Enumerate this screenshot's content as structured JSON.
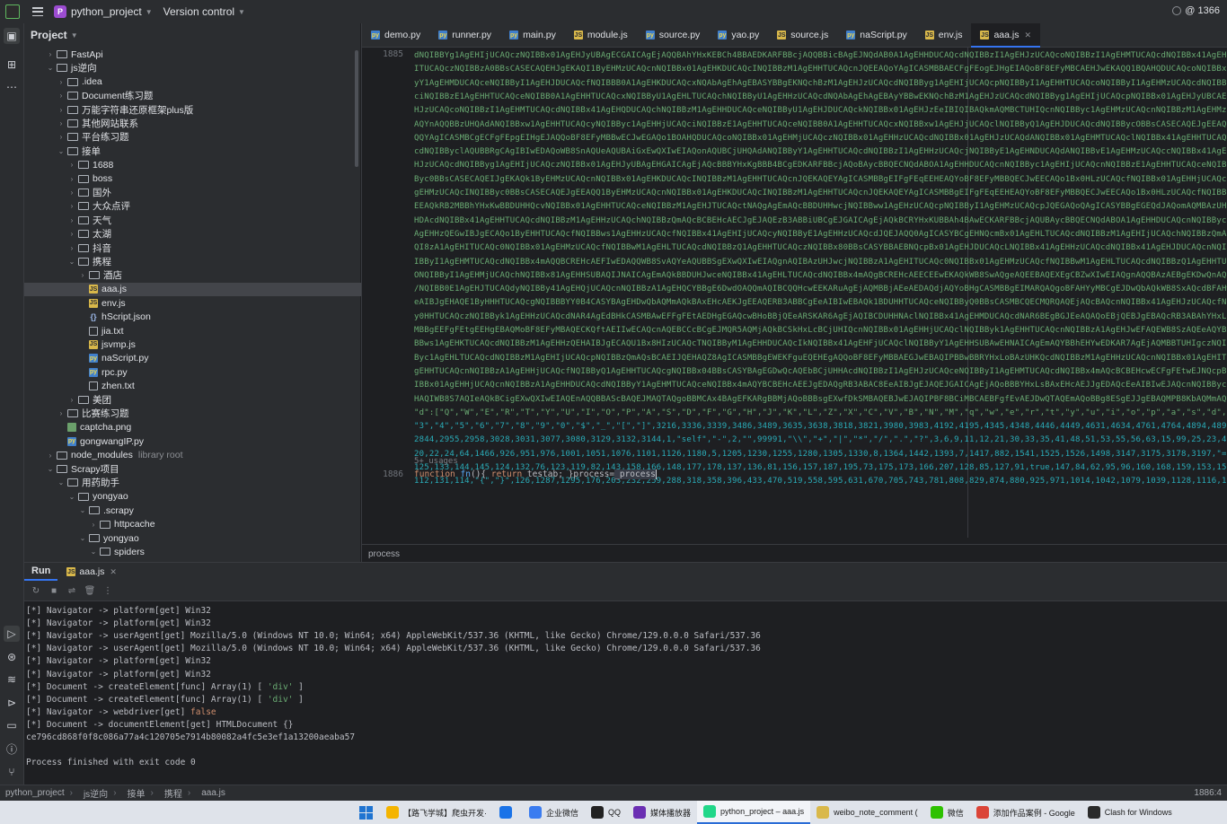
{
  "titlebar": {
    "project_badge": "P",
    "project_name": "python_project",
    "version_control": "Version control",
    "right_label": "@ 1366"
  },
  "project_panel": {
    "header": "Project",
    "tree": [
      {
        "label": "FastApi",
        "type": "folder",
        "depth": 1,
        "expanded": false
      },
      {
        "label": "js逆向",
        "type": "folder",
        "depth": 1,
        "expanded": true
      },
      {
        "label": ".idea",
        "type": "folder",
        "depth": 2,
        "expanded": false
      },
      {
        "label": "Document练习题",
        "type": "folder",
        "depth": 2,
        "expanded": false
      },
      {
        "label": "万能字符串还原框架plus版",
        "type": "folder",
        "depth": 2,
        "expanded": false
      },
      {
        "label": "其他网站联系",
        "type": "folder",
        "depth": 2,
        "expanded": false
      },
      {
        "label": "平台练习题",
        "type": "folder",
        "depth": 2,
        "expanded": false
      },
      {
        "label": "接单",
        "type": "folder",
        "depth": 2,
        "expanded": true
      },
      {
        "label": "1688",
        "type": "folder",
        "depth": 3,
        "expanded": false
      },
      {
        "label": "boss",
        "type": "folder",
        "depth": 3,
        "expanded": false
      },
      {
        "label": "国外",
        "type": "folder",
        "depth": 3,
        "expanded": false
      },
      {
        "label": "大众点评",
        "type": "folder",
        "depth": 3,
        "expanded": false
      },
      {
        "label": "天气",
        "type": "folder",
        "depth": 3,
        "expanded": false
      },
      {
        "label": "太湖",
        "type": "folder",
        "depth": 3,
        "expanded": false
      },
      {
        "label": "抖音",
        "type": "folder",
        "depth": 3,
        "expanded": false
      },
      {
        "label": "携程",
        "type": "folder",
        "depth": 3,
        "expanded": true
      },
      {
        "label": "酒店",
        "type": "folder",
        "depth": 4,
        "expanded": false
      },
      {
        "label": "aaa.js",
        "type": "js",
        "depth": 4,
        "selected": true
      },
      {
        "label": "env.js",
        "type": "js",
        "depth": 4
      },
      {
        "label": "hScript.json",
        "type": "json",
        "depth": 4
      },
      {
        "label": "jia.txt",
        "type": "txt",
        "depth": 4
      },
      {
        "label": "jsvmp.js",
        "type": "js",
        "depth": 4
      },
      {
        "label": "naScript.py",
        "type": "py",
        "depth": 4
      },
      {
        "label": "rpc.py",
        "type": "py",
        "depth": 4
      },
      {
        "label": "zhen.txt",
        "type": "txt",
        "depth": 4
      },
      {
        "label": "美团",
        "type": "folder",
        "depth": 3,
        "expanded": false
      },
      {
        "label": "比赛练习题",
        "type": "folder",
        "depth": 2,
        "expanded": false
      },
      {
        "label": "captcha.png",
        "type": "png",
        "depth": 2
      },
      {
        "label": "gongwangIP.py",
        "type": "py",
        "depth": 2
      },
      {
        "label": "node_modules",
        "type": "folder",
        "depth": 1,
        "expanded": false,
        "extra": "library root"
      },
      {
        "label": "Scrapy项目",
        "type": "folder",
        "depth": 1,
        "expanded": true
      },
      {
        "label": "用药助手",
        "type": "folder",
        "depth": 2,
        "expanded": true
      },
      {
        "label": "yongyao",
        "type": "folder",
        "depth": 3,
        "expanded": true
      },
      {
        "label": ".scrapy",
        "type": "folder",
        "depth": 4,
        "expanded": true
      },
      {
        "label": "httpcache",
        "type": "folder",
        "depth": 5,
        "expanded": false
      },
      {
        "label": "yongyao",
        "type": "folder",
        "depth": 4,
        "expanded": true
      },
      {
        "label": "spiders",
        "type": "folder",
        "depth": 5,
        "expanded": true
      }
    ]
  },
  "editor": {
    "tabs": [
      {
        "label": "demo.py",
        "type": "py"
      },
      {
        "label": "runner.py",
        "type": "py"
      },
      {
        "label": "main.py",
        "type": "py"
      },
      {
        "label": "module.js",
        "type": "js"
      },
      {
        "label": "source.py",
        "type": "py"
      },
      {
        "label": "yao.py",
        "type": "py"
      },
      {
        "label": "source.js",
        "type": "js"
      },
      {
        "label": "naScript.py",
        "type": "py"
      },
      {
        "label": "env.js",
        "type": "js"
      },
      {
        "label": "aaa.js",
        "type": "js",
        "active": true
      }
    ],
    "line_numbers": {
      "first": "1885",
      "second": "1886"
    },
    "code_lines": [
      "dNQIBBYg1AgEHIjUCAQczNQIBBx01AgEHJyUBAgECGAICAgEjAQQBAhYHxKEBCh4BBAEDKARFBBcjAQQBBicBAgEJNQdAB0A1AgEHHDUCAQcdNQIBBzI1AgEHJzUCAQcoNQIBBzI1AgEHMTUCAQcdNQIBBx41AgEHQDUCAQcdNQIBBzZ",
      "ITUCAQczNQIBBzA0BBsCASECAQEHJgEKAQI1ByEHMzUCAQcnNQIBBx01AgEHKDUCAQcINQIBBzM1AgEHHTUCAQcnJQEEAQoYAgICASMBBAECFgFEogEJHgEIAQoBF8EFyMBCAEHJwEKAQQ1BQAHQDUCAQcoNQIBBx01AgEHMjUCAQcz",
      "yY1AgEHMDUCAQceNQIBByI1AgEHJDUCAQcfNQIBBB0A1AgEHKDUCAQcxNQAbAgEhAgEBASYBBgEKNQchBzM1AgEHJzUCAQcdNQIBByg1AgEHIjUCAQcpNQIBByI1AgEHHTUCAQcoNQIBByI1AgEHMzUCAQcdNQIBByc1AgEH",
      "ciNQIBBzE1AgEHHTUCAQceNQIBB0A1AgEHHTUCAQcxNQIBByU1AgEHLTUCAQchNQIBByU1AgEHHzUCAQcdNQAbAgEhAgEBAyYBBwEKNQchBzM1AgEHJzUCAQcdNQIBByg1AgEHIjUCAQcpNQIBBx01AgEHJyUBCAEJGAICAgEjBQECBQ",
      "HJzUCAQcoNQIBBzI1AgEHMTUCAQcdNQIBBx41AgEHQDUCAQchNQIBBzM1AgEHHDUCAQceNQIBByU1AgEHJDUCAQckNQIBBx01AgEHJzEeIBIQIBAQkmAQMBCTUHIQcnNQIBByc1AgEHMzUCAQcnNQIBBzM1AgEHMzUCAQcdNQIBBx0",
      "AQYnAQQBBzUHQAdANQIBBxw1AgEHHTUCAQcyNQIBByc1AgEHHjUCAQciNQIBBzE1AgEHHTUCAQceNQIBB0A1AgEHHTUCAQcxNQIBBxw1AgEHJjUCAQclNQIBByQ1AgEHJDUCAQcdNQIBBycOBBsCASECAQEJgEEAQQ1ByEHMzUCAQcn",
      "QQYAgICASMBCgECFgFEpgEIHgEJAQQoBF8EFyMBBwECJwEGAQo1BOAHQDUCAQcoNQIBBx01AgEHMjUCAQczNQIBBx01AgEHHzUCAQcdNQIBBx01AgEHJzUCAQdANQIBBx01AgEHMTUCAQclNQIBBx41AgEHHTUCAQcgNQIBBzI1AgEHMT",
      "cdNQIBByclAQUBBRgCAgIBIwEDAQoWB8SnAQUeAQUBAiGxEwQXIwEIAQonAQUBCjUHQAdANQIBByY1AgEHHTUCAQcdNQIBBzI1AgEHHzUCAQcjNQIBByE1AgEHNDUCAQdANQIBBvE1AgEHMzUCAQccNQIBBx41AgEHJTUCAQcdNQIB",
      "HJzUCAQcdNQIBByg1AgEHIjUCAQczNQIBBx01AgEHJyUBAgEHGAICAgEjAQcBBBYHxKgBBB4BCgEDKARFBBcjAQoBAycBBQECNQdABOA1AgEHHDUCAQcnNQIBByc1AgEHIjUCAQcnNQIBBzE1AgEHHTUCAQceNQIBB0A1AgEHHTUCA",
      "Byc0BBsCASECAQEIJgEKAQk1ByEHMzUCAQcnNQIBBx01AgEHKDUCAQcINQIBBzM1AgEHHTUCAQcnJQEKAQEYAgICASMBBgEIFgFEqEEHEAQYoBF8EFyMBBQECJwEECAQo1Bx0HLzUCAQcfNQIBBx01AgEHHjUCAQcnNQIBByU1AgEHM",
      "gEHMzUCAQcINQIBByc0BBsCASECAQEJgEEAQQ1ByEHMzUCAQcnNQIBBx01AgEHKDUCAQcINQIBBzM1AgEHHTUCAQcnJQEKAQEYAgICASMBBgEIFgFEqEEHEAQYoBF8EFyMBBQECJwEECAQo1Bx0HLzUCAQcfNQIBBx01AgEHHjUCAQc",
      "EEAQkRB2MBBhYHxKwBBDUHHQcvNQIBBx01AgEHHTUCAQceNQIBBzM1AgEHJTUCAQctNAQgAgEmAQcBBDUHHwcjNQIBBww1AgEHzUCAQcpNQIBByI1AgEHMzUCAQcpJQEGAQoQAgICASYBBgEGEQdJAQomAQMBAzUHIgczNQIBBzc1AgEH",
      "HDAcdNQIBBx41AgEHHTUCAQcdNQIBBzM1AgEHHzUCAQchNQIBBzQmAQcBCBEHcAECJgEJAQEzB3ABBiUBCgEJGAICAgEjAQkBCRYHxKUBBAh4BAwECKARFBBcjAQUBAycBBQECNQdABOA1AgEHHDUCAQcnNQIBByc1AgEHIjUCAQcn",
      "AgEHHzQEGwIBJgECAQo1ByEHHTUCAQcfNQIBBws1AgEHHzUCAQcfNQIBBx41AgEHIjUCAQcyNQIBByE1AgEHHzUCAQcdJQEJAQQ0AgICASYBCgEHNQcmBx01AgEHLTUCAQcdNQIBBzM1AgEHIjUCAQchNQIBBzQmAQEBAREHcAEIwEB",
      "QI8zA1AgEHITUCAQc0NQIBBx01AgEHMzUCAQcfNQIBBwM1AgEHLTUCAQcdNQIBBzQ1AgEHHTUCAQczNQIBBx80BBsCASYBBAEBNQcpBx01AgEHJDUCAQcLNQIBBx41AgEHHzUCAQcdNQIBBx41AgEHJDUCAQcnNQIBBzA1AgEHHSUBAQ",
      "IBByI1AgEHMTUCAQcdNQIBBx4mAQQBCREHcAEFIwEDAQQWB8SvAQYeAQUBBSgEXwQXIwEIAQgnAQIBAzUHJwcjNQIBBzA1AgEHITUCAQc0NQIBBx01AgEHMzUCAQcfNQIBBwM1AgEHLTUCAQcdNQIBBzQ1AgEHHTUCAQczNQIBBx80BB",
      "ONQIBByI1AgEHMjUCAQchNQIBBx81AgEHHSUBAQIJNAICAgEmAQkBBDUHJwceNQIBBx41AgEHLTUCAQcdNQIBBx4mAQgBCREHcAEECEEwEKAQkWB8SwAQgeAQEEBAQEXEgCBZwXIwEIAQgnAQQBAzAEBgEKDwQnAQgmAQkBCDUHHDdgc",
      "/NQIBB0E1AgEHJTUCAQdyNQIBBy41AgEHQjUCAQcnNQIBBzA1AgEHQCYBBgE6DwdOAQQmAQIBCQQHcwEEKARuAgEjAQMBBjAEeAEDAQdjAQYoBHgCASMBBgEIMARQAQgoBFAHYyMBCgEJDwQbAQkWB8SxAQcdBFAHwpDjAQcBBxYHxLIB",
      "eAIBJgEHAQE1ByHHHTUCAQcgNQIBBBYY0B4CASYBAgEHDwQbAQMmAQkBAxEHcAEKJgEEAQERB3ABBCgEeAIBIwEBAQk1BDUHHTUCAQceNQIBByQ0BBsCASMBCQECMQRQAQEjAQcBAQcnNQIBBx41AgEHJzUCAQcfNQIBByM0BBsCASMBCQEC",
      "y0HHTUCAQczNQIBByk1AgEHHzUCAQcdNAR4AgEdBHkCASMBAwEFFgFEtAEDHgEGAQcwBHoBBjQEeARSKAR6AgEjAQIBCDUHHNAclNQIBBx41AgEHMDUCAQcdNAR6BEgBGJEeAQAQoEBjQEBJgEBAQcRB3ABAhYHxLUBBzQEGwR6JgEHAQY1BD",
      "MBBgEEFgFEtgEEHgEBAQMoBF8EFyMBAQECKQftAEIIwECAQcnAQEBCCcBCgEJMQR5AQMjAQkBCSkHxLcBCjUHIQcnNQIBBx01AgEHHjUCAQclNQIBByk1AgEHHTUCAQcnNQIBBzA1AgEHJwEFAQEWB8SzAQEeAQYBAQEoBF0EFyMBBwEDKABAoBCj",
      "BBws1AgEHKTUCAQcdNQIBBzM1AgEHHzQEHAIBJgECAQU1Bx8HIzUCAQcTNQIBByM1AgEHHDUCAQcIkNQIBBx41AgEHFjUCAQclNQIBByY1AgEHHSUBAwEHNAICAgEmAQYBBhEHYwEDKAR7AgEjAQMBBTUHIgczNQIBByc1AgEHHDUCAQcdNQ",
      "Byc1AgEHLTUCAQcdNQIBBzM1AgEHIjUCAQcpNQIBBzQmAQsBCAEIJQEHAQZ8AgICASMBBgEWEKFguEQEHEgAQQoBF8EFyMBBAEGJwEBAQIPBBwBBRYHxLoBAzUHKQcdNQIBBzM1AgEHHzUCAQcnNQIBBx01AgEHITUCAQcd",
      "gEHHTUCAQcnNQIBBzA1AgEHHjUCAQcfNQIBByQ1AgEHHTUCAQcgNQIBBx04BBsCASYBAgEGDwQcAQEbBCjUHHAcdNQIBBzI1AgEHJzUCAQceNQIBByI1AgEHMTUCAQcdNQIBBx4mAQcBCBEHcwECFgFEtwEJNQcpBx01AgEHMzUCAQcf",
      "IBBx01AgEHHjUCAQcnNQIBBzA1AgEHHDUCAQcdNQIBByY1AgEHMTUCAQceNQIBBx4mAQYBCBEHcAEEJgEDAQgRB3ABAC8EeAIBJgEJAQEJGAICAgEjAQoBBBYHxLsBAxEHcAEJJgEDAQcEeAIBIwEJAQcnNQIBByc1AgEHHjUCAQc",
      "HAQIWB8S7AQIeAQkBCigEXwQXIwEIAQEnAQQBBAScBAQEJMAQTAQgoBBMCAx4BAgEFKARgBBMjAQoBBBsgEXwfDkSMBAQEBJwEJAQIPBF8BCiMBCAEBFgfEvAEJDwQTAQEmAQoBBg8ESgEJJgEBAQMPB8KbAQMmAQgBAhEHcwEIKQfEvQE",
      "\"d\":[\"Q\",\"W\",\"E\",\"R\",\"T\",\"Y\",\"U\",\"I\",\"O\",\"P\",\"A\",\"S\",\"D\",\"F\",\"G\",\"H\",\"J\",\"K\",\"L\",\"Z\",\"X\",\"C\",\"V\",\"B\",\"N\",\"M\",\"q\",\"w\",\"e\",\"r\",\"t\",\"y\",\"u\",\"i\",\"o\",\"p\",\"a\",\"s\",\"d\",\"f\",\"g\",\"h\",\"j\",",
      "\"3\",\"4\",\"5\",\"6\",\"7\",\"8\",\"9\",\"0\",\"$\",\"_\",\"[\",\"]\",3216,3336,3339,3486,3489,3635,3638,3818,3821,3980,3983,4192,4195,4345,4348,4446,4449,4631,4634,4761,4764,4894,4897,5039,5042,517",
      "2844,2955,2958,3028,3031,3077,3080,3129,3132,3144,1,\"self\",\"-\",2,\"\",99991,\"\\\\\",\"+\",\"|\",\"*\",\"/\",\".\",\"?\",3,6,9,11,12,21,30,33,35,41,48,51,53,55,56,63,15,99,25,23,43,54,13,32,36,4",
      "20,22,24,64,1466,926,951,976,1001,1051,1076,1101,1126,1180,5,1205,1230,1255,1280,1305,1330,8,1364,1442,1393,7,1417,882,1541,1525,1526,1498,3147,3175,3178,3197,\"=\",\":\",67,13131,",
      "125,133,144,145,124,132,76,123,119,82,143,158,166,148,177,178,137,136,81,156,157,187,195,73,175,173,166,207,128,85,127,91,true,147,84,62,95,96,160,168,159,153,155,\" \",179,1",
      "112,131,114,\"{\",\"}\",126,1287,1295,176,203,232,259,288,318,358,396,433,470,519,558,595,631,670,705,743,781,808,829,874,880,925,971,1014,1042,1079,1039,1128,1116,1124,1083,1144,1"
    ],
    "usages_hint": "5+ usages",
    "fn_line": {
      "kw_function": "function",
      "fn_name": "fn",
      "rest": "(){ ",
      "kw_return": "return",
      "body": " testab; }process=",
      "highlighted": "_process"
    },
    "breadcrumb": "process"
  },
  "run_panel": {
    "title": "Run",
    "tab_label": "aaa.js",
    "console": [
      {
        "text": "[*] Navigator -> platform[get] Win32"
      },
      {
        "text": "[*] Navigator -> platform[get] Win32"
      },
      {
        "text": "[*] Navigator -> userAgent[get] Mozilla/5.0 (Windows NT 10.0; Win64; x64) AppleWebKit/537.36 (KHTML, like Gecko) Chrome/129.0.0.0 Safari/537.36"
      },
      {
        "text": "[*] Navigator -> userAgent[get] Mozilla/5.0 (Windows NT 10.0; Win64; x64) AppleWebKit/537.36 (KHTML, like Gecko) Chrome/129.0.0.0 Safari/537.36"
      },
      {
        "text": "[*] Navigator -> platform[get] Win32"
      },
      {
        "text": "[*] Navigator -> platform[get] Win32"
      },
      {
        "text": "[*] Document -> createElement[func] Array(1) [ ",
        "str": "'div'",
        "tail": " ]"
      },
      {
        "text": "[*] Document -> createElement[func] Array(1) [ ",
        "str": "'div'",
        "tail": " ]"
      },
      {
        "text": "[*] Navigator -> webdriver[get] ",
        "bool": "false"
      },
      {
        "text": "[*] Document -> documentElement[get] HTMLDocument {}"
      },
      {
        "text": "ce796cd868f0f8c086a77a4c120705e7914b80082a4fc5e3ef1a13200aeaba57"
      },
      {
        "text": ""
      },
      {
        "text": "Process finished with exit code 0"
      }
    ]
  },
  "statusbar": {
    "crumbs": [
      "python_project",
      "js逆向",
      "接单",
      "携程",
      "aaa.js"
    ],
    "position": "1886:4"
  },
  "taskbar": {
    "items": [
      {
        "label": "【路飞学城】爬虫开发·",
        "color": "#f4b400"
      },
      {
        "label": "",
        "color": "#1a73e8"
      },
      {
        "label": "企业微信",
        "color": "#3a7cf0"
      },
      {
        "label": "QQ",
        "color": "#222222"
      },
      {
        "label": "媒体播放器",
        "color": "#6b2fb3"
      },
      {
        "label": "python_project – aaa.js",
        "color": "#21d789",
        "active": true
      },
      {
        "label": "weibo_note_comment (",
        "color": "#d9b84a"
      },
      {
        "label": "微信",
        "color": "#2dc100"
      },
      {
        "label": "添加作品案例 - Google",
        "color": "#db4437"
      },
      {
        "label": "Clash for Windows",
        "color": "#2a2a2a"
      }
    ]
  }
}
